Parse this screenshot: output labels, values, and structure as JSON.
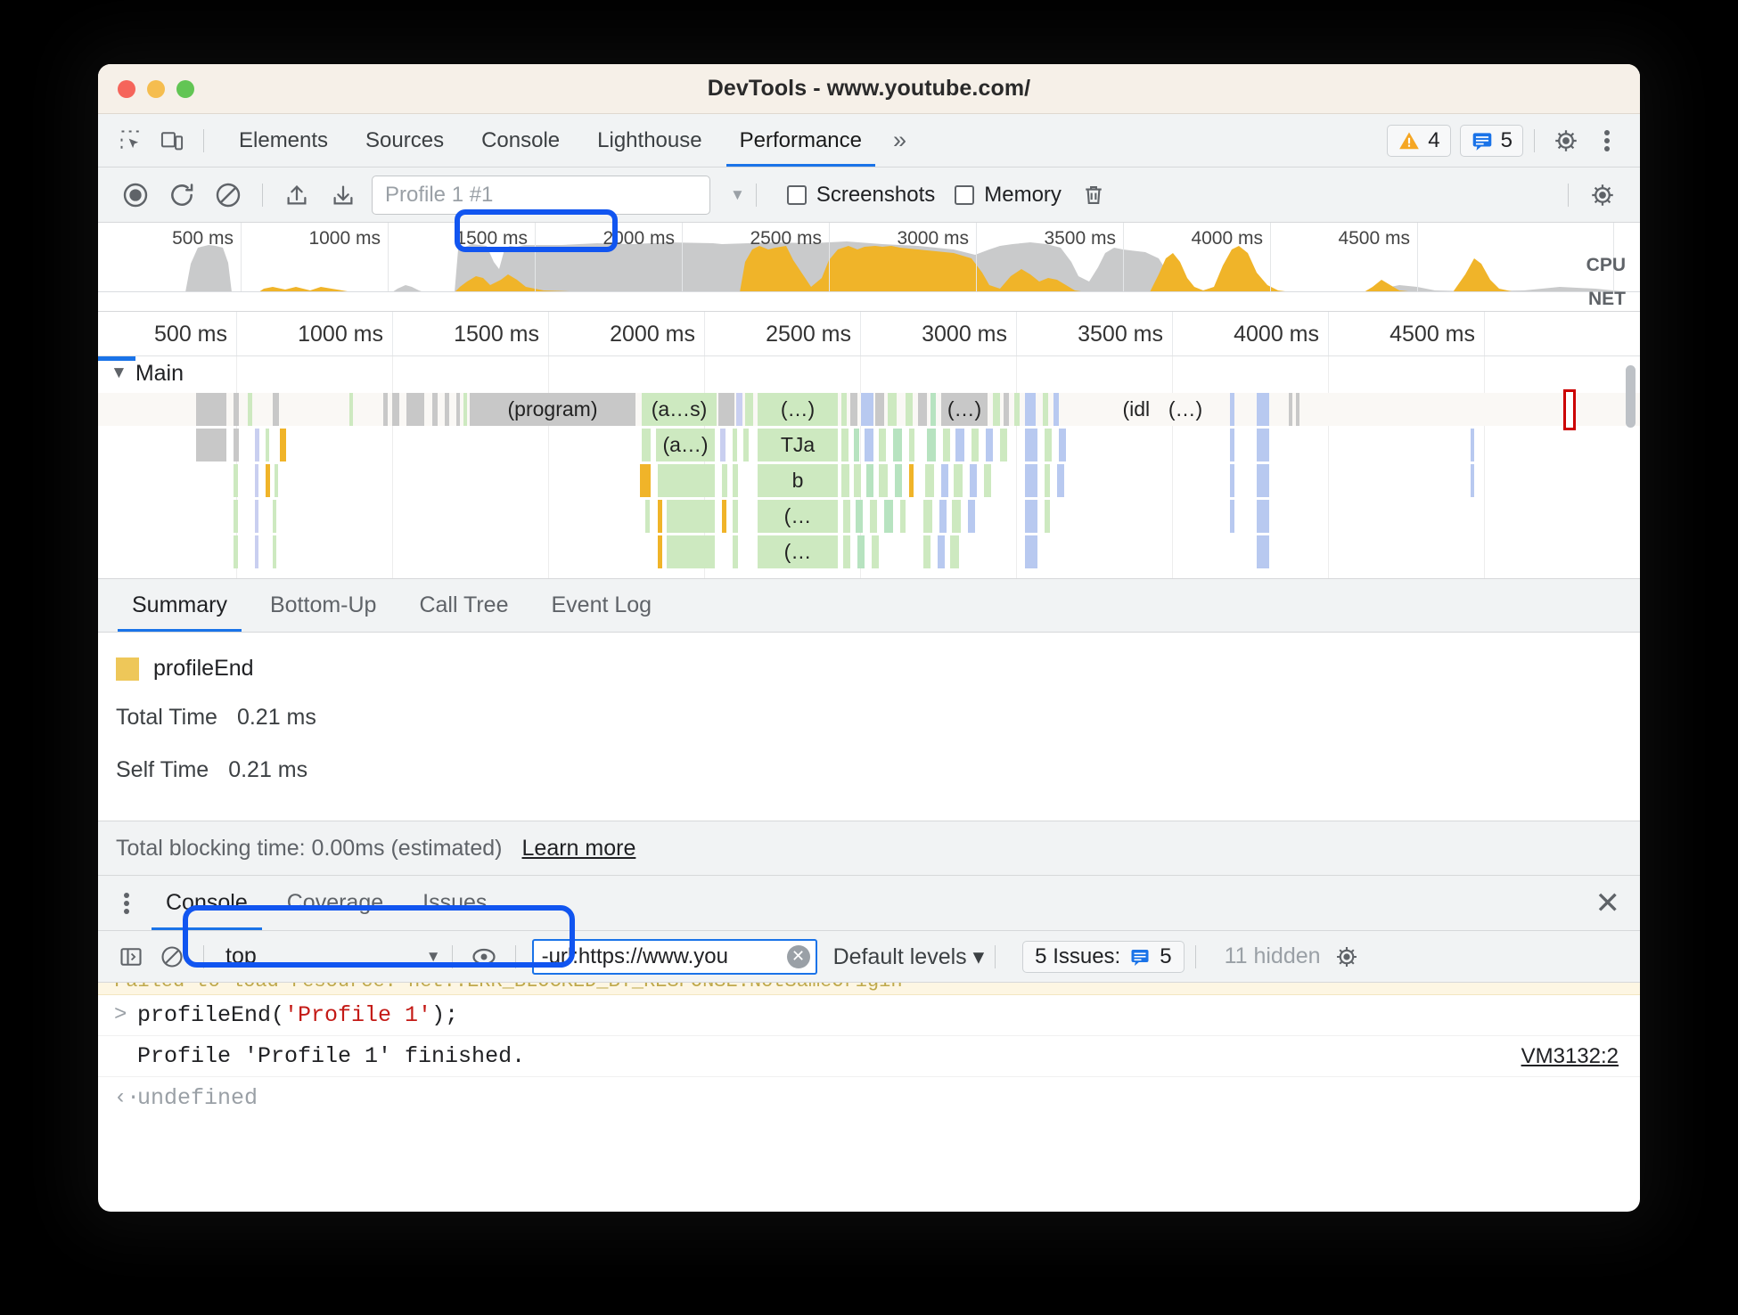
{
  "window": {
    "title": "DevTools - www.youtube.com/",
    "traffic_lights": [
      "close",
      "minimize",
      "maximize"
    ]
  },
  "tabstrip": {
    "left_icons": [
      "inspect-icon",
      "device-toolbar-icon"
    ],
    "tabs": [
      {
        "label": "Elements",
        "active": false
      },
      {
        "label": "Sources",
        "active": false
      },
      {
        "label": "Console",
        "active": false
      },
      {
        "label": "Lighthouse",
        "active": false
      },
      {
        "label": "Performance",
        "active": true
      }
    ],
    "more_tabs": "»",
    "warning_count": "4",
    "message_count": "5",
    "right_icons": [
      "gear-icon",
      "kebab-menu-icon"
    ]
  },
  "perf_toolbar": {
    "icons": [
      "record-icon",
      "reload-record-icon",
      "clear-icon",
      "upload-icon",
      "download-icon"
    ],
    "profile_name": "Profile 1 #1",
    "screenshots_label": "Screenshots",
    "screenshots_checked": false,
    "memory_label": "Memory",
    "memory_checked": false,
    "trash_icon": "delete-icon",
    "capture_settings_icon": "gear-icon"
  },
  "overview": {
    "ticks": [
      "500 ms",
      "1000 ms",
      "1500 ms",
      "2000 ms",
      "2500 ms",
      "3000 ms",
      "3500 ms",
      "4000 ms",
      "4500 ms"
    ],
    "cpu_label": "CPU",
    "net_label": "NET"
  },
  "flame": {
    "ruler_ticks": [
      "500 ms",
      "1000 ms",
      "1500 ms",
      "2000 ms",
      "2500 ms",
      "3000 ms",
      "3500 ms",
      "4000 ms",
      "4500 ms"
    ],
    "track_name": "Main",
    "track_expanded": true,
    "blocks": {
      "program": "(program)",
      "as": "(a…s)",
      "dots1": "(…)",
      "dots2": "(…)",
      "idle": "(idle)",
      "dots3": "(…)",
      "a2": "(a…)",
      "tja": "TJa",
      "b": "b",
      "dots4": "(…",
      "dots5": "(…"
    }
  },
  "detail_tabs": [
    {
      "label": "Summary",
      "active": true
    },
    {
      "label": "Bottom-Up",
      "active": false
    },
    {
      "label": "Call Tree",
      "active": false
    },
    {
      "label": "Event Log",
      "active": false
    }
  ],
  "summary": {
    "legend_color": "#eec759",
    "legend_name": "profileEnd",
    "rows": [
      {
        "label": "Total Time",
        "value": "0.21 ms"
      },
      {
        "label": "Self Time",
        "value": "0.21 ms"
      }
    ],
    "blocking_text": "Total blocking time: 0.00ms (estimated)",
    "learn_more": "Learn more"
  },
  "drawer": {
    "tabs": [
      {
        "label": "Console",
        "active": true
      },
      {
        "label": "Coverage",
        "active": false
      },
      {
        "label": "Issues",
        "active": false
      }
    ],
    "close_icon": "close-icon",
    "filter": {
      "sidebar_icon": "console-sidebar-icon",
      "clear_icon": "clear-console-icon",
      "context": "top",
      "eye_icon": "live-expression-icon",
      "filter_value": "-url:https://www.you",
      "clear_filter_icon": "clear-input-icon",
      "levels": "Default levels ▾",
      "issues_pill": "5 Issues:",
      "issues_count": "5",
      "hidden": "11 hidden",
      "settings_icon": "gear-icon"
    },
    "messages": {
      "warn_ghost": "Failed to load resource: net::ERR_BLOCKED_BY_RESPONSE.NotSameOrigin",
      "input_prompt": ">",
      "input_pre": "profileEnd(",
      "input_str": "'Profile 1'",
      "input_post": ");",
      "result_text": "Profile 'Profile 1' finished.",
      "result_source": "VM3132:2",
      "return_prompt": "‹·",
      "return_value": "undefined"
    }
  },
  "annotations": {
    "color": "#1155f0",
    "targets": [
      "profile-selector",
      "console-profileEnd-output"
    ]
  }
}
